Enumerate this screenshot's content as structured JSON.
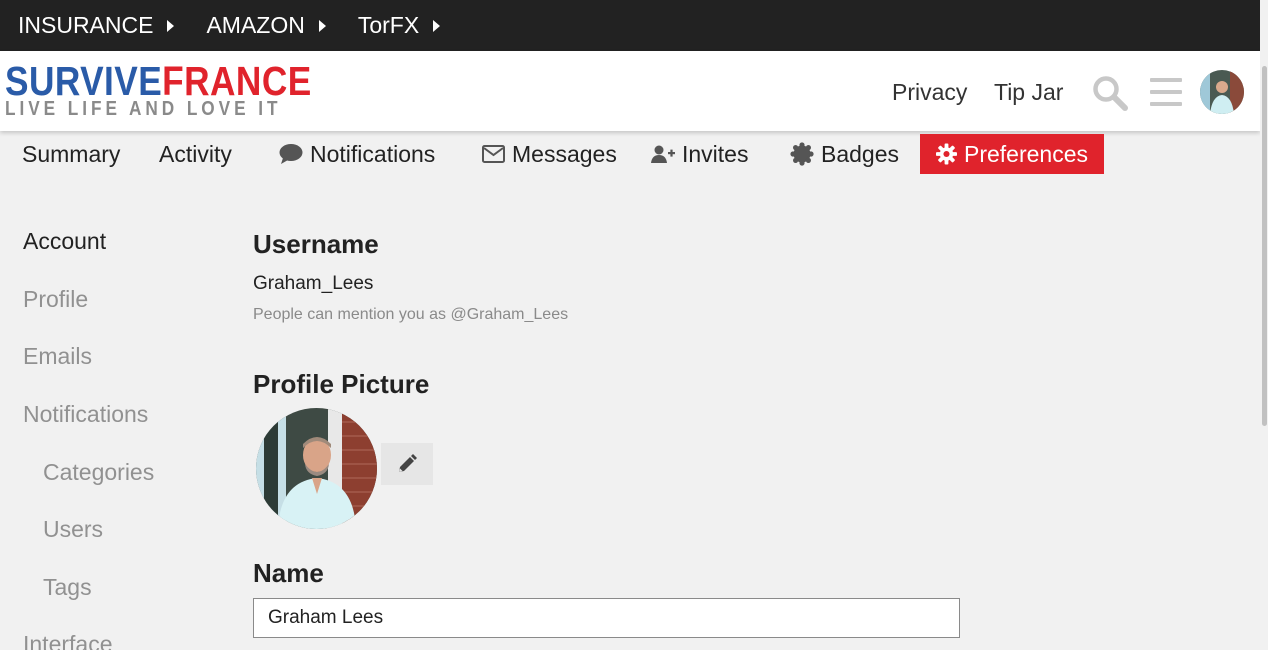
{
  "topbar": {
    "items": [
      "INSURANCE",
      "AMAZON",
      "TorFX"
    ]
  },
  "header": {
    "logo_line1_a": "SURVIVE",
    "logo_line1_b": "FRANCE",
    "logo_line2": "LIVE LIFE AND LOVE IT",
    "privacy": "Privacy",
    "tipjar": "Tip Jar"
  },
  "tabs": {
    "summary": "Summary",
    "activity": "Activity",
    "notifications": "Notifications",
    "messages": "Messages",
    "invites": "Invites",
    "badges": "Badges",
    "preferences": "Preferences"
  },
  "sidenav": {
    "account": "Account",
    "profile": "Profile",
    "emails": "Emails",
    "notifications": "Notifications",
    "categories": "Categories",
    "users": "Users",
    "tags": "Tags",
    "interface": "Interface"
  },
  "main": {
    "username_heading": "Username",
    "username_value": "Graham_Lees",
    "username_hint": "People can mention you as @Graham_Lees",
    "picture_heading": "Profile Picture",
    "name_heading": "Name",
    "name_value": "Graham Lees"
  },
  "colors": {
    "topbar_bg": "#222222",
    "accent_red": "#e0232c",
    "logo_blue": "#2a5ba8",
    "page_bg": "#f1f1f1"
  },
  "icons": {
    "search": "search-icon",
    "menu": "hamburger-icon",
    "notifications": "speech-bubble-icon",
    "messages": "envelope-icon",
    "invites": "user-plus-icon",
    "badges": "certificate-icon",
    "preferences": "gear-icon",
    "edit": "pencil-icon"
  }
}
